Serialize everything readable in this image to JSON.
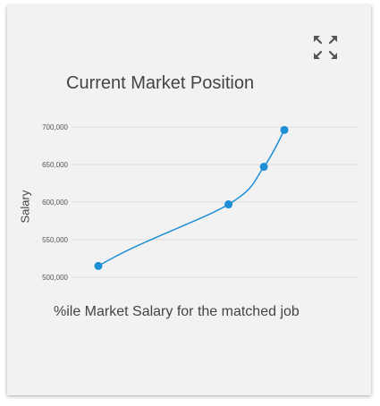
{
  "card": {
    "expand_icon": "expand-arrows-icon"
  },
  "chart_data": {
    "type": "line",
    "title": "Current Market Position",
    "ylabel": "Salary",
    "xlabel": "%ile Market Salary for the matched job",
    "ylim": [
      500000,
      700000
    ],
    "yticks": [
      {
        "value": 500000,
        "label": "500,000"
      },
      {
        "value": 550000,
        "label": "550,000"
      },
      {
        "value": 600000,
        "label": "600,000"
      },
      {
        "value": 650000,
        "label": "650,000"
      },
      {
        "value": 700000,
        "label": "700,000"
      }
    ],
    "xlim": [
      0,
      100
    ],
    "points": [
      {
        "x": 0,
        "y": 515000
      },
      {
        "x": 70,
        "y": 597000
      },
      {
        "x": 89,
        "y": 647000
      },
      {
        "x": 100,
        "y": 696000
      }
    ],
    "grid": true,
    "line_color": "#1e8fd6",
    "grid_color": "#dcdcdc"
  }
}
